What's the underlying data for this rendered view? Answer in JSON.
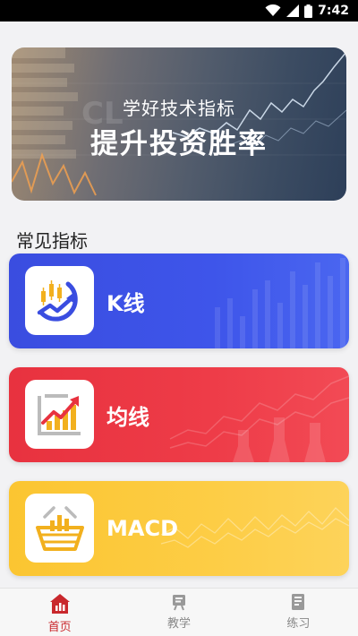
{
  "status_bar": {
    "time": "7:42"
  },
  "banner": {
    "subtitle": "学好技术指标",
    "title": "提升投资胜率"
  },
  "section": {
    "title": "常见指标"
  },
  "cards": [
    {
      "label": "K线",
      "color": "#3e55ea",
      "icon": "candlestick-trend-icon"
    },
    {
      "label": "均线",
      "color": "#ee3c48",
      "icon": "rising-bar-chart-icon"
    },
    {
      "label": "MACD",
      "color": "#fdcd45",
      "icon": "basket-chart-icon"
    }
  ],
  "tabbar": {
    "tabs": [
      {
        "label": "首页",
        "icon": "home-chart-icon",
        "active": true
      },
      {
        "label": "教学",
        "icon": "teaching-board-icon",
        "active": false
      },
      {
        "label": "练习",
        "icon": "notebook-icon",
        "active": false
      }
    ],
    "active_color": "#c9282d"
  }
}
